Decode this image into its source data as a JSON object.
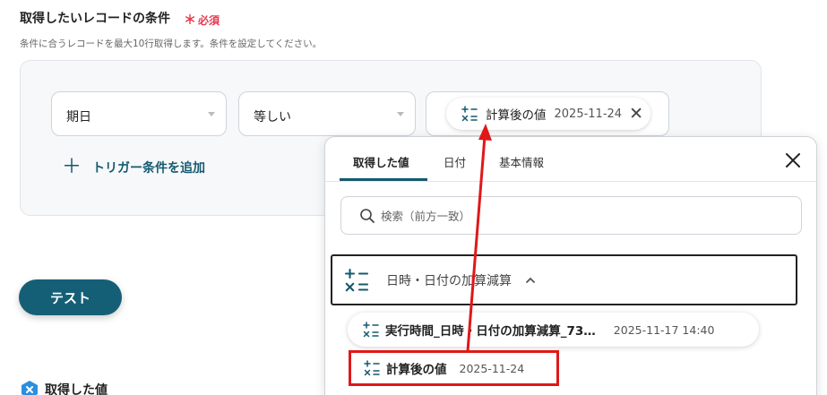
{
  "condition_section": {
    "title": "取得したいレコードの条件",
    "required_label": "必須",
    "required_mark": "＊",
    "description": "条件に合うレコードを最大10行取得します。条件を設定してください。"
  },
  "condition_row": {
    "field_value": "期日",
    "operator_value": "等しい",
    "value_chip": {
      "label": "計算後の値",
      "date": "2025-11-24",
      "close_glyph": "✕"
    }
  },
  "add_trigger": {
    "plus": "＋",
    "label": "トリガー条件を追加"
  },
  "test_button": "テスト",
  "result_section": {
    "title": "取得した値"
  },
  "value_picker": {
    "tabs": [
      {
        "label": "取得した値",
        "active": true
      },
      {
        "label": "日付",
        "active": false
      },
      {
        "label": "基本情報",
        "active": false
      }
    ],
    "search_placeholder": "検索（前方一致）",
    "group": {
      "label": "日時・日付の加算減算",
      "expanded": true
    },
    "items": [
      {
        "label": "実行時間_日時・日付の加算減算_73…",
        "date": "2025-11-17 14:40"
      },
      {
        "label": "計算後の値",
        "date": "2025-11-24",
        "highlighted": true
      }
    ]
  },
  "colors": {
    "brand": "#15596f",
    "required": "#e8394d",
    "annotation": "#e01818"
  },
  "icons": [
    "calculator-icon",
    "close-icon",
    "search-icon",
    "chevron-up-icon",
    "plus-icon",
    "yoom-badge-icon"
  ]
}
